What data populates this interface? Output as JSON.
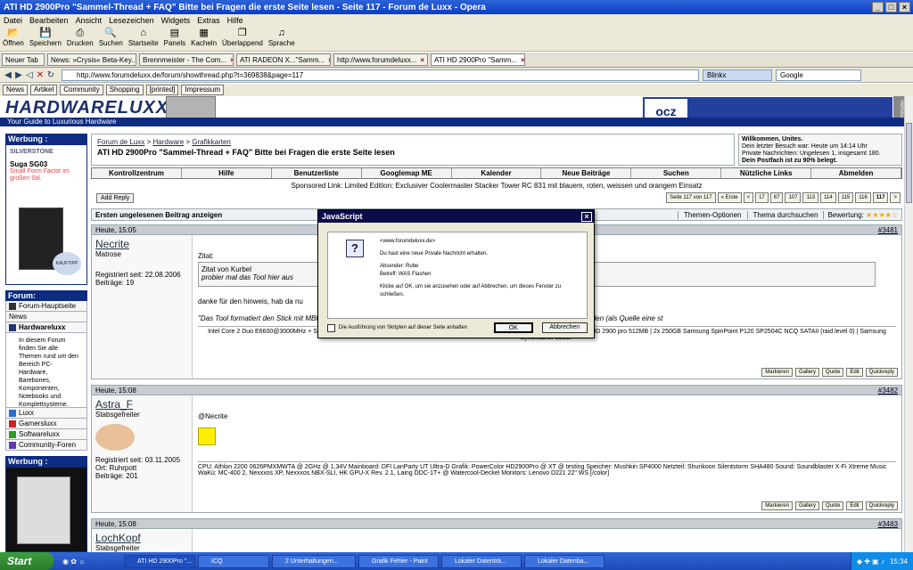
{
  "window": {
    "title": "ATI HD 2900Pro \"Sammel-Thread + FAQ\" Bitte bei Fragen die erste Seite lesen - Seite 117 - Forum de Luxx - Opera"
  },
  "menu": [
    "Datei",
    "Bearbeiten",
    "Ansicht",
    "Lesezeichen",
    "Widgets",
    "Extras",
    "Hilfe"
  ],
  "toolbar": [
    "Öffnen",
    "Speichern",
    "Drucken",
    "Suchen",
    "Startseite",
    "Panels",
    "Kacheln",
    "Überlappend",
    "Sprache"
  ],
  "tabs": [
    {
      "label": "Neuer Tab"
    },
    {
      "label": "News: »Crysis« Beta-Key..."
    },
    {
      "label": "Brennmeister - The Com..."
    },
    {
      "label": "ATI RADEON X...\"Samm..."
    },
    {
      "label": "http://www.forumdeluxx..."
    },
    {
      "label": "ATI HD 2900Pro \"Samm..."
    }
  ],
  "address": {
    "url": "http://www.forumdeluxx.de/forum/showthread.php?t=369838&page=117",
    "search_engine": "Blinkx",
    "search_placeholder": "Google"
  },
  "personalbar": [
    "News",
    "Artikel",
    "Community",
    "Shopping",
    "[printed]",
    "Impressum"
  ],
  "site": {
    "logo": "HARDWARELUXX",
    "tagline": "Your Guide to Luxurious Hardware",
    "ocz": "ocz",
    "verlosung": "Verlosung"
  },
  "sidebar": {
    "ad_heading": "Werbung :",
    "ad1_brand": "SILVERSTONE",
    "ad1_model": "Suga SG03",
    "ad1_text": "Small Form Factor im großen Stil.",
    "ad1_badge": "KAUFTIPP",
    "forum_heading": "Forum:",
    "forum_items": [
      "Forum-Hauptseite",
      "News",
      "Hardwareluxx"
    ],
    "forum_desc": "In diesem Forum finden Sie alle Themen rund um den Bereich PC-Hardware, Barebones, Komponenten, Notebooks und Komplettsysteme.",
    "other_items": [
      "Luxx",
      "Gamersluxx",
      "Softwareluxx",
      "Community-Foren"
    ],
    "ad2_heading": "Werbung :"
  },
  "breadcrumb": {
    "root": "Forum de Luxx",
    "l1": "Hardware",
    "l2": "Grafikkarten",
    "thread": "ATI HD 2900Pro \"Sammel-Thread + FAQ\" Bitte bei Fragen die erste Seite lesen"
  },
  "welcome": {
    "line1": "Willkommen, Unites.",
    "line2": "Dein letzter Besuch war: Heute um 14:14 Uhr",
    "line3": "Private Nachrichten: Ungelesen 1, insgesamt 180.",
    "line4": "Dein Postfach ist zu 90% belegt."
  },
  "navtable": [
    "Kontrollzentrum",
    "Hilfe",
    "Benutzerliste",
    "Googlemap ME",
    "Kalender",
    "Neue Beiträge",
    "Suchen",
    "Nützliche Links",
    "Abmelden"
  ],
  "sponsored": "Sponsored Link: Limited Edition: Exclusiver Coolermaster Stacker Tower RC 831 mit blauem, roten, weissen und orangem Einsatz",
  "add_reply": "Add Reply",
  "pagination": {
    "label": "Seite 117 von 117",
    "items": [
      "« Erste",
      "<",
      "17",
      "67",
      "107",
      "113",
      "114",
      "115",
      "116",
      "117",
      ">"
    ]
  },
  "first_unread": "Ersten ungelesenen Beitrag anzeigen",
  "thread_tools": {
    "options": "Themen-Optionen",
    "search": "Thema durchsuchen",
    "rating": "Bewertung:"
  },
  "posts": [
    {
      "time": "Heute, 15:05",
      "num": "#3481",
      "user": "Necrite",
      "rank": "Matrose",
      "reg": "Registriert seit: 22.08.2006",
      "beitraege": "Beiträge: 19",
      "quote_label": "Zitat:",
      "quote_by": "Zitat von Kurbel",
      "quote_text": "probier mal das Tool hier aus",
      "text1": "danke für den hinweis, hab da nu",
      "text2": "\"Das Tool formatiert den Stick mit MBR, Partitionstabelle, Partition) und kann direkt eine startbare DOS-Umgebung mit einbinden (als Quelle eine st",
      "sig": "Intel Core 2 Duo E6600@3000MHz + Scythe Ninja | ASRock ConRoeXFire-eSATA2.0 | 2x1024MB MDT PC667 CL4 4-4-4-15-4 | Sapphire HD 2900 pro 512MB | 2x 250GB Samsung SpinPoint P120 SP2504C NCQ SATAII (raid level 0) | Samsung SyncMaster 930BF"
    },
    {
      "time": "Heute, 15:08",
      "num": "#3482",
      "user": "Astra_F",
      "rank": "Stabsgefreiter",
      "reg": "Registriert seit: 03.11.2005",
      "ort": "Ort: Ruhrpott",
      "beitraege": "Beiträge: 201",
      "text1": "@Necrite",
      "sig": "CPU: Athlon 2200 0626PMXMWTA @ 2GHz @ 1,34V Mainboard: DFI LanParty UT Ultra-D Grafik: PowerColor HD2900Pro @ XT @ testing Speicher: Mushkin SP4000 Netzteil: Shurikoon Silentstorm SHA480 Sound: Soundblaster X-Fi Xtreme Music WaKü: MC-400 2, Nexxxos XP, Nexxxos NBX-SLI, HK GPU-X Rev. 2.1, Laing DDC-1T+ @ Watercool-Deckel Monitors: Lenovo D221 22\" WS [/color]"
    },
    {
      "time": "Heute, 15:08",
      "num": "#3483",
      "user": "LochKopf",
      "rank": "Stabsgefreiter"
    }
  ],
  "post_actions": [
    "Markieren",
    "Gallery",
    "Quote",
    "Edit",
    "Quickreply"
  ],
  "dialog": {
    "title": "JavaScript",
    "from": "<www.forumdeluxx.de>",
    "line1": "Du hast eine neue Private Nachricht erhalten.",
    "absender": "Absender: Rube",
    "betreff": "Betreff: WAS Flashen",
    "line4": "Klicke auf OK, um sie anzusehen oder auf Abbrechen, um dieses Fenster zu schließen.",
    "checkbox": "Die Ausführung von Skripten auf dieser Seite anhalten",
    "ok": "OK",
    "cancel": "Abbrechen"
  },
  "taskbar": {
    "start": "Start",
    "tasks": [
      "ATI HD 2900Pro \"...",
      "ICQ",
      "2 Unterhaltungen...",
      "Grafik Fehler - Paint",
      "Lokaler Datenträ...",
      "Lokaler Datenba..."
    ],
    "clock": "15:34"
  }
}
